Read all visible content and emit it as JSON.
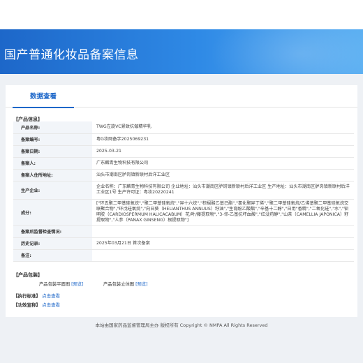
{
  "header": {
    "title": "国产普通化妆品备案信息"
  },
  "tabs": [
    {
      "label": "数据查看"
    }
  ],
  "section_product_info": "【产品信息】",
  "rows": [
    {
      "label": "产品名称:",
      "value": "TWG左旋VC紧致抗皱精华乳"
    },
    {
      "label": "备案编号:",
      "value": "粤G妆网备字2025069231"
    },
    {
      "label": "备案日期:",
      "value": "2025-03-21"
    },
    {
      "label": "备案人:",
      "value": "广东麟青生物科技有限公司"
    },
    {
      "label": "备案人住所地址:",
      "value": "汕头市潮南区胪岗镇新联村后洋工业区"
    },
    {
      "label": "生产企业:",
      "value": "企业名称：广东麟青生物科技有限公司 企业地址：汕头市潮南区胪岗镇新联村后洋工业区 生产地址：汕头市潮南区胪岗镇新联村后洋工业区1号 生产许可证：粤妆20220241"
    },
    {
      "label": "成分:",
      "value": "[\"环五聚二甲基硅氧烷\",\"聚二甲基硅氧烷\",\"异十六烷\",\"棕榈酸乙基己酯\",\"氯化聚异丁烯\",\"聚二甲基硅氧烷/乙烯基聚二甲基硅氧烷交联聚合物\",\"环戊硅氧烷\",\"向日葵（HELIANTHUS ANNUUS）籽油\",\"生育酚乙酸酯\",\"辛基十二醇\",\"日用\"香精\",\"二氧化硅\",\"水\",\"钡明胶（CARDIOSPERMUM HALICACABUM）花/叶/藤提取物\",\"3-邻-乙基抗坏血酸\",\"红没药醇\",\"山茶（CAMELLIA JAPONICA）籽提取物\",\"人参（PANAX GINSENG）根提取物\"]"
    },
    {
      "label": "备案后监督检查情况:",
      "value": ""
    },
    {
      "label": "历史记录:",
      "value": "2025年03月21日 首次备案"
    },
    {
      "label": "备注:",
      "value": ""
    }
  ],
  "section_package": "【产品包装】",
  "package": [
    {
      "label": "产品包装平面图",
      "link": "[预览]"
    },
    {
      "label": "产品包装立体图",
      "link": "[预览]"
    }
  ],
  "standard": {
    "label": "【执行标准】",
    "link": "点击查看"
  },
  "efficacy": {
    "label": "【功效宣称】",
    "link": "点击查看"
  },
  "footer": {
    "text": "本站由国家药品监督管理局主办 版权所有 Copyright © NMPA All Rights Reserved"
  }
}
